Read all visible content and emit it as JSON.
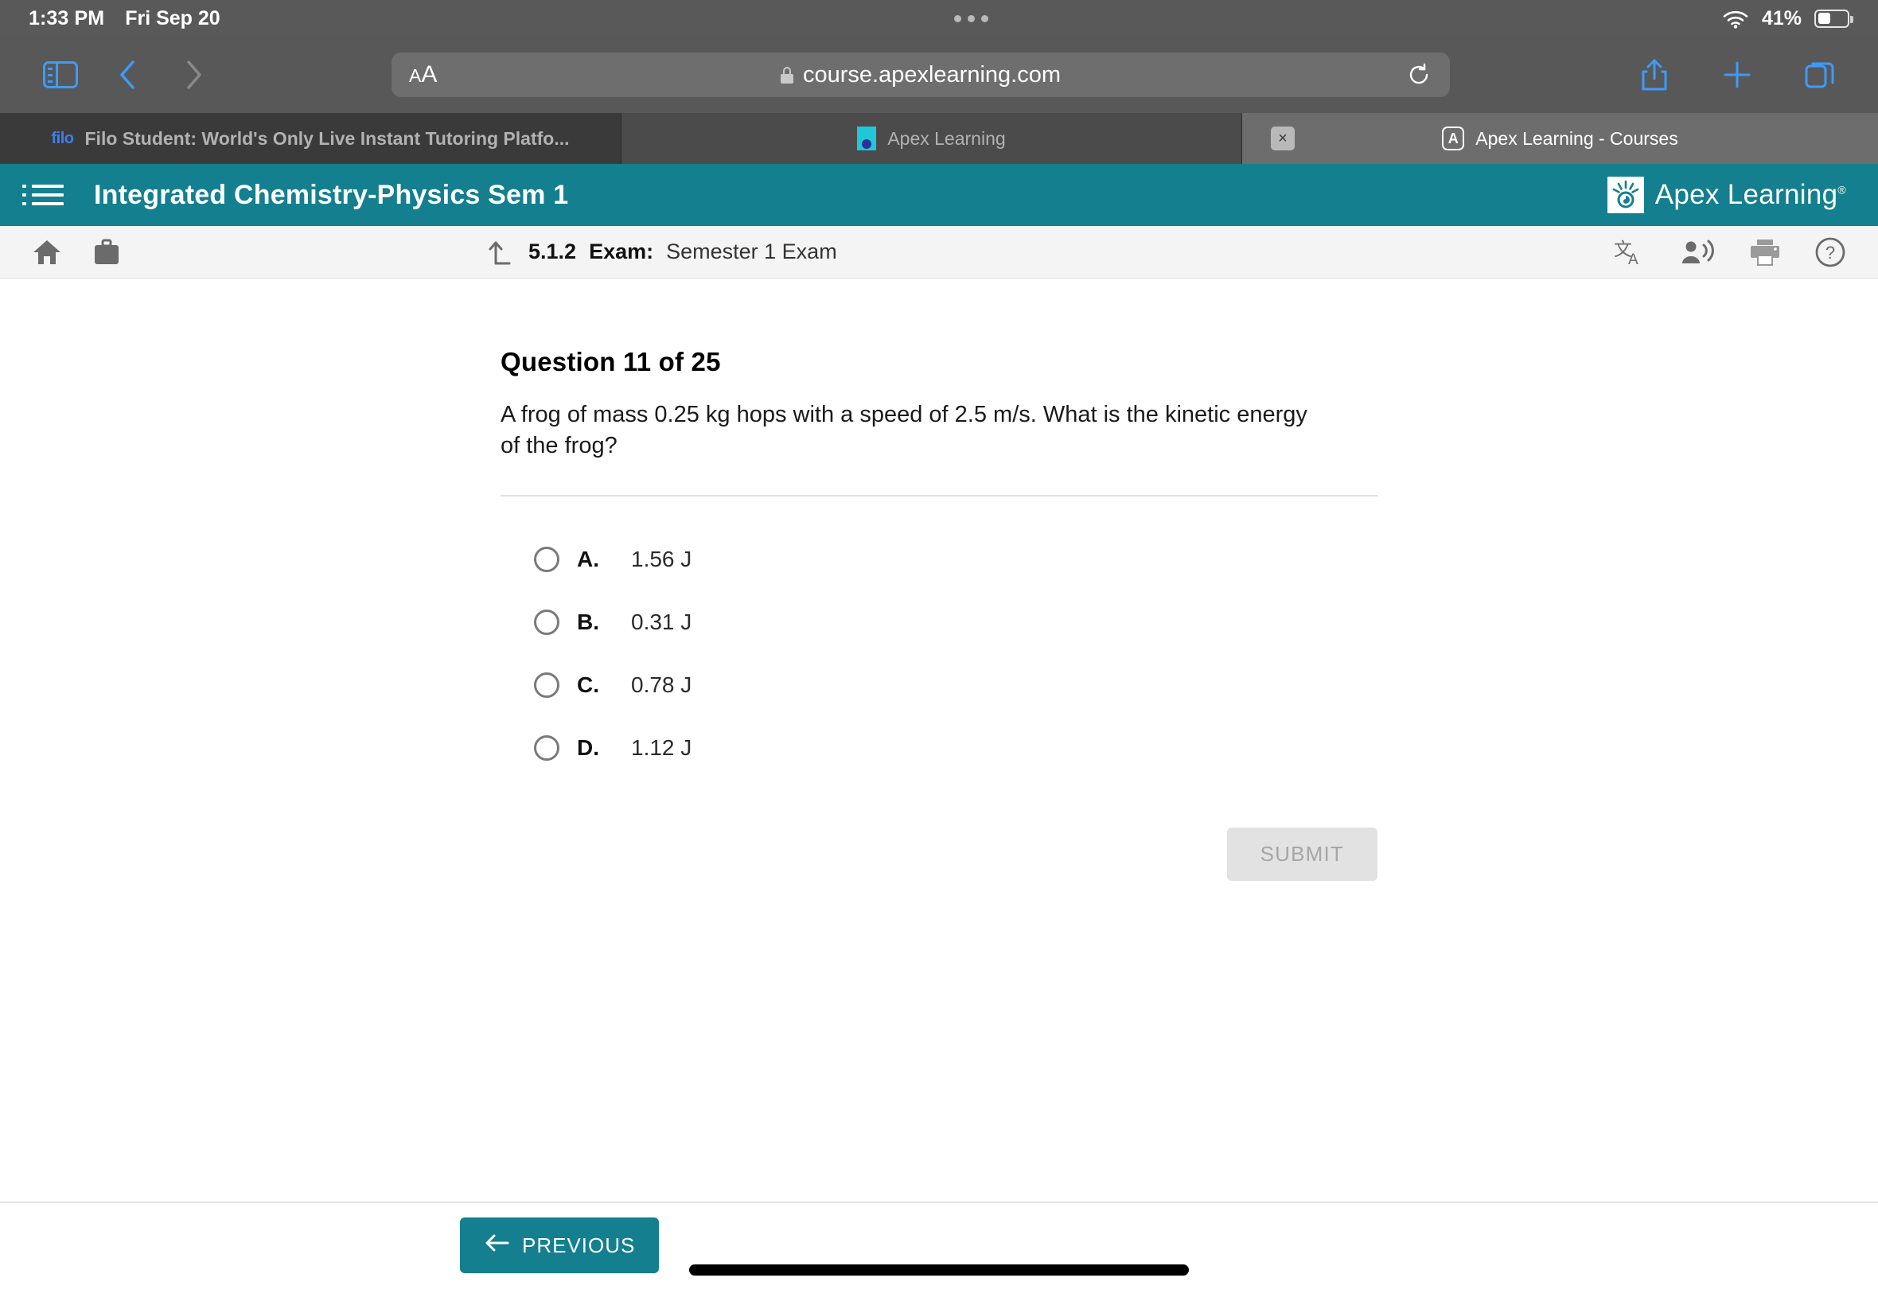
{
  "status_bar": {
    "time": "1:33 PM",
    "date": "Fri Sep 20",
    "battery_percent": "41%",
    "wifi_icon": "wifi-icon",
    "battery_icon": "battery-icon"
  },
  "browser": {
    "sidebar_icon": "sidebar-icon",
    "back_icon": "chevron-left-icon",
    "forward_icon": "chevron-right-icon",
    "text_size_label": "AA",
    "text_size_small": "A",
    "text_size_large": "A",
    "lock_icon": "lock-icon",
    "url": "course.apexlearning.com",
    "reload_icon": "reload-icon",
    "share_icon": "share-icon",
    "new_tab_icon": "plus-icon",
    "tabs_overview_icon": "tabs-icon",
    "tabs": [
      {
        "favicon": "filo-favicon",
        "favicon_text": "filo",
        "title": "Filo Student: World's Only Live Instant Tutoring Platfo...",
        "active": false,
        "has_close": false
      },
      {
        "favicon": "apex-favicon",
        "favicon_text": "",
        "title": "Apex Learning",
        "active": false,
        "has_close": false
      },
      {
        "favicon": "apex-courses-favicon",
        "favicon_text": "A",
        "title": "Apex Learning - Courses",
        "active": true,
        "has_close": true,
        "close_label": "×"
      }
    ]
  },
  "course_header": {
    "menu_icon": "hamburger-menu-icon",
    "title": "Integrated Chemistry-Physics Sem 1",
    "brand_name": "Apex Learning",
    "brand_trademark": "®",
    "brand_color": "#137f8f"
  },
  "sub_toolbar": {
    "home_icon": "home-icon",
    "briefcase_icon": "briefcase-icon",
    "level_up_icon": "level-up-arrow-icon",
    "breadcrumb_code": "5.1.2",
    "breadcrumb_type": "Exam:",
    "breadcrumb_name": "Semester 1 Exam",
    "translate_icon": "translate-icon",
    "read_aloud_icon": "read-aloud-icon",
    "print_icon": "print-icon",
    "help_icon": "help-icon"
  },
  "question": {
    "heading": "Question 11 of 25",
    "number": 11,
    "total": 25,
    "text": "A frog of mass 0.25 kg hops with a speed of 2.5 m/s. What is the kinetic energy of the frog?",
    "options": [
      {
        "letter": "A.",
        "text": "1.56 J",
        "selected": false
      },
      {
        "letter": "B.",
        "text": "0.31 J",
        "selected": false
      },
      {
        "letter": "C.",
        "text": "0.78 J",
        "selected": false
      },
      {
        "letter": "D.",
        "text": "1.12 J",
        "selected": false
      }
    ],
    "submit_label": "SUBMIT",
    "submit_disabled": true
  },
  "bottom_bar": {
    "previous_label": "PREVIOUS",
    "previous_icon": "arrow-left-icon",
    "home_indicator": "home-indicator"
  }
}
